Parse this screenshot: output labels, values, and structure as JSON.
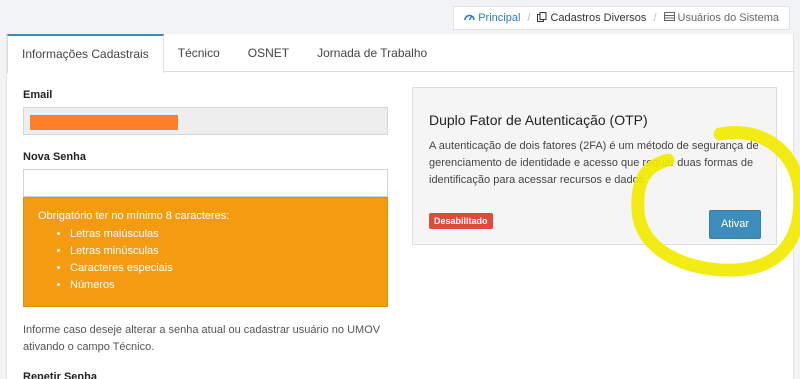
{
  "breadcrumb": {
    "items": [
      {
        "label": "Principal",
        "icon": "dashboard-icon"
      },
      {
        "label": "Cadastros Diversos",
        "icon": "copy-icon"
      },
      {
        "label": "Usuários do Sistema",
        "icon": "table-icon"
      }
    ]
  },
  "tabs": [
    {
      "label": "Informações Cadastrais",
      "active": true
    },
    {
      "label": "Técnico",
      "active": false
    },
    {
      "label": "OSNET",
      "active": false
    },
    {
      "label": "Jornada de Trabalho",
      "active": false
    }
  ],
  "form": {
    "email_label": "Email",
    "email_value": "",
    "new_password_label": "Nova Senha",
    "new_password_value": "",
    "requirements": {
      "intro": "Obrigatório ter no mínimo 8 caracteres:",
      "items": [
        "Letras maiúsculas",
        "Letras minúsculas",
        "Caracteres especiais",
        "Números"
      ]
    },
    "help_text": "Informe caso deseje alterar a senha atual ou cadastrar usuário no UMOV ativando o campo Técnico.",
    "repeat_password_label": "Repetir Senha"
  },
  "otp": {
    "title": "Duplo Fator de Autenticação (OTP)",
    "description": "A autenticação de dois fatores (2FA) é um método de segurança de gerenciamento de identidade e acesso que requer duas formas de identificação para acessar recursos e dados.",
    "status_badge": "Desabilitado",
    "activate_button": "Ativar"
  },
  "colors": {
    "accent": "#3c8dbc",
    "warning": "#f39c12",
    "danger": "#dd4b39",
    "redaction": "#ff7f2a",
    "annotation": "#f2ea00"
  }
}
